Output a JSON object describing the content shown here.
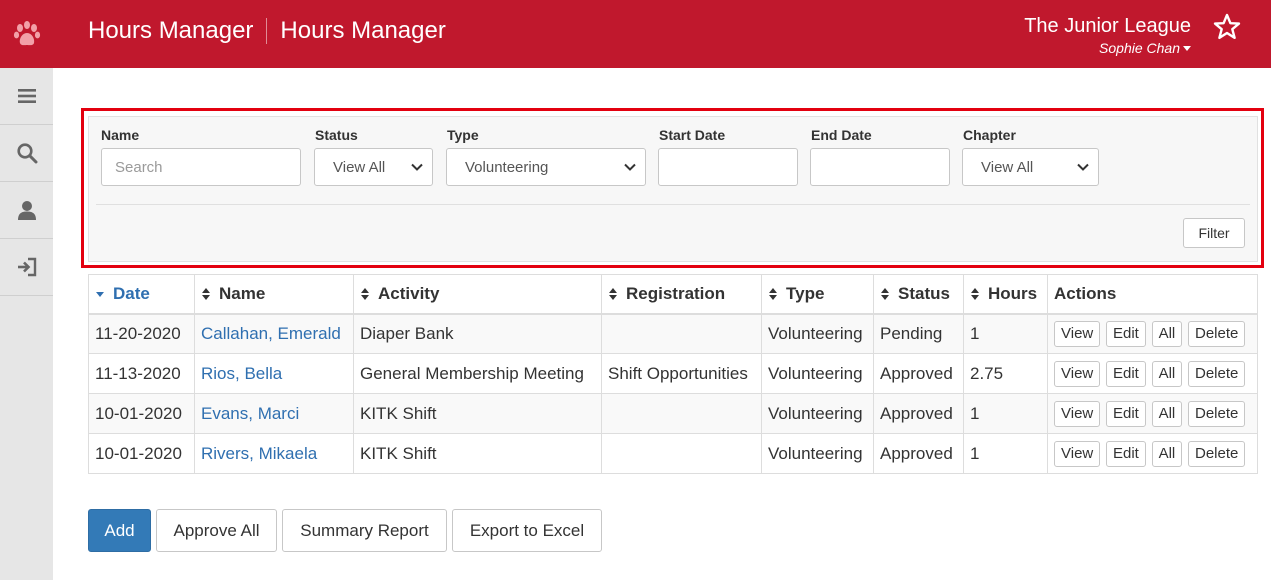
{
  "header": {
    "app_title": "Hours Manager",
    "page_title": "Hours Manager",
    "org_name": "The Junior League",
    "user_name": "Sophie Chan",
    "brand_color": "#c0182d"
  },
  "sidebar": {
    "items": [
      {
        "icon": "menu-icon"
      },
      {
        "icon": "search-icon"
      },
      {
        "icon": "user-icon"
      },
      {
        "icon": "sign-in-icon"
      }
    ]
  },
  "filters": {
    "name": {
      "label": "Name",
      "placeholder": "Search",
      "value": ""
    },
    "status": {
      "label": "Status",
      "value": "View All"
    },
    "type": {
      "label": "Type",
      "value": "Volunteering"
    },
    "start_date": {
      "label": "Start Date",
      "value": ""
    },
    "end_date": {
      "label": "End Date",
      "value": ""
    },
    "chapter": {
      "label": "Chapter",
      "value": "View All"
    },
    "filter_button": "Filter"
  },
  "table": {
    "columns": [
      "Date",
      "Name",
      "Activity",
      "Registration",
      "Type",
      "Status",
      "Hours",
      "Actions"
    ],
    "sorted_column": "Date",
    "rows": [
      {
        "date": "11-20-2020",
        "name": "Callahan, Emerald",
        "activity": "Diaper Bank",
        "registration": "",
        "type": "Volunteering",
        "status": "Pending",
        "hours": "1"
      },
      {
        "date": "11-13-2020",
        "name": "Rios, Bella",
        "activity": "General Membership Meeting",
        "registration": "Shift Opportunities",
        "type": "Volunteering",
        "status": "Approved",
        "hours": "2.75"
      },
      {
        "date": "10-01-2020",
        "name": "Evans, Marci",
        "activity": "KITK Shift",
        "registration": "",
        "type": "Volunteering",
        "status": "Approved",
        "hours": "1"
      },
      {
        "date": "10-01-2020",
        "name": "Rivers, Mikaela",
        "activity": "KITK Shift",
        "registration": "",
        "type": "Volunteering",
        "status": "Approved",
        "hours": "1"
      }
    ],
    "row_actions": [
      "View",
      "Edit",
      "All",
      "Delete"
    ]
  },
  "actions": {
    "add": "Add",
    "approve_all": "Approve All",
    "summary_report": "Summary Report",
    "export_excel": "Export to Excel"
  }
}
